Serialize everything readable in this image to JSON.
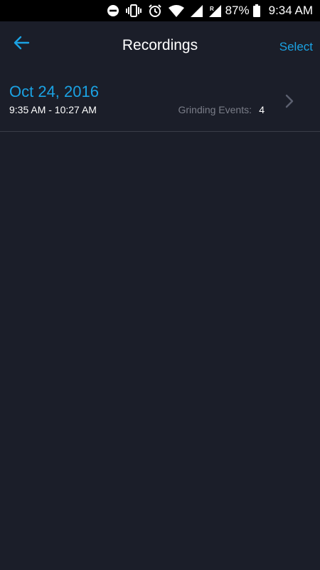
{
  "status_bar": {
    "battery_percent": "87%",
    "time": "9:34 AM",
    "icons": [
      "do-not-disturb-icon",
      "vibrate-icon",
      "alarm-icon",
      "wifi-icon",
      "signal-icon",
      "roaming-signal-icon",
      "battery-icon"
    ]
  },
  "header": {
    "back_icon": "arrow-left-icon",
    "title": "Recordings",
    "select_label": "Select"
  },
  "recordings": [
    {
      "date": "Oct 24, 2016",
      "time_range": "9:35 AM - 10:27 AM",
      "events_label": "Grinding Events:",
      "events_count": "4",
      "chevron_icon": "chevron-right-icon"
    }
  ],
  "colors": {
    "accent": "#1ba2e3",
    "background": "#1b1e29",
    "status_bar": "#000000",
    "divider": "#3a3d48",
    "muted_text": "#7a7d88"
  }
}
